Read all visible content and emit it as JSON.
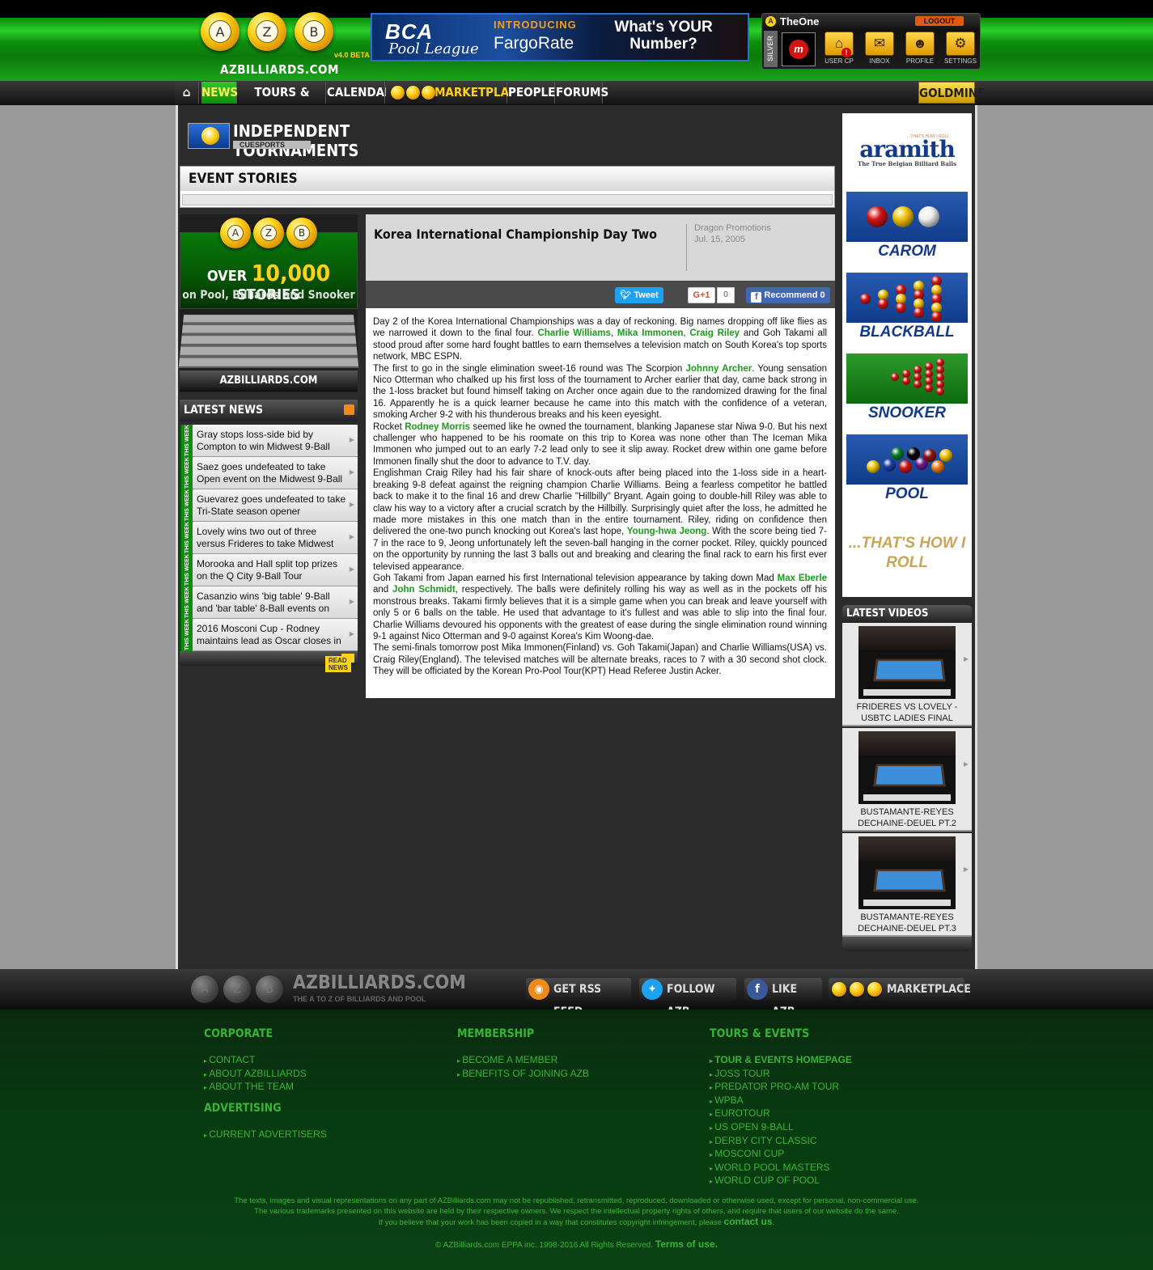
{
  "header": {
    "logo_balls": [
      "A",
      "Z",
      "B"
    ],
    "logo_text": "AZBILLIARDS.COM",
    "version": "v4.0 BETA",
    "banner": {
      "brand": "BCA",
      "league": "Pool League",
      "introducing": "INTRODUCING",
      "product": "FargoRate",
      "question": "What's YOUR Number?"
    },
    "user": {
      "name": "TheOne",
      "logout": "LOGOUT",
      "rank": "SILVER",
      "buttons": [
        "USER CP",
        "INBOX",
        "PROFILE",
        "SETTINGS"
      ]
    }
  },
  "nav": {
    "items": [
      "NEWS",
      "TOURS & EVENTS",
      "CALENDAR",
      "MARKETPLACE",
      "PEOPLE",
      "FORUMS"
    ],
    "goldmine": "GOLDMINE"
  },
  "section": {
    "title": "INDEPENDENT TOURNAMENTS",
    "subtitle": "CUESPORTS",
    "event_stories": "EVENT STORIES"
  },
  "promo": {
    "over": "OVER",
    "count": "10,000",
    "stories": "STORIES",
    "sub": "on Pool, Billiards and Snooker",
    "site": "AZBILLIARDS.COM"
  },
  "latest_news": {
    "title": "LATEST NEWS",
    "badge": "THIS WEEK",
    "items": [
      "Gray stops loss-side bid by Compton to win Midwest 9-Ball",
      "Saez goes undefeated to take Open event on the Midwest 9-Ball",
      "Guevarez goes undefeated to take Tri-State season opener",
      "Lovely wins two out of three versus Frideres to take Midwest",
      "Morooka and Hall split top prizes on the Q City 9-Ball Tour",
      "Casanzio wins 'big table' 9-Ball and 'bar table' 8-Ball events on",
      "2016 Mosconi Cup - Rodney maintains lead as Oscar closes in"
    ],
    "read_more": "READ NEWS"
  },
  "article": {
    "title": "Korea International Championship Day Two",
    "source": "Dragon Promotions",
    "date": "Jul. 15, 2005",
    "tweet": "Tweet",
    "gplus": "G+1",
    "gplus_count": "0",
    "recommend": "Recommend 0",
    "paragraphs": [
      [
        "Day 2 of the Korea International Championships was a day of reckoning. Big names dropping off like flies as we narrowed it down to the final four. ",
        {
          "b": "Charlie Williams"
        },
        ", ",
        {
          "b": "Mika Immonen"
        },
        ", ",
        {
          "b": "Craig Riley"
        },
        " and Goh Takami all stood proud after some hard fought battles to earn themselves a television match on South Korea's top sports network, MBC ESPN."
      ],
      [
        "The first to go in the single elimination sweet-16 round was The Scorpion ",
        {
          "b": "Johnny Archer"
        },
        ". Young sensation Nico Otterman who chalked up his first loss of the tournament to Archer earlier that day, came back strong in the 1-loss bracket but found himself taking on Archer once again due to the randomized drawing for the final 16. Apparently he is a quick learner because he came into this match with the confidence of a veteran, smoking Archer 9-2 with his thunderous breaks and his keen eyesight."
      ],
      [
        "Rocket ",
        {
          "b": "Rodney Morris"
        },
        " seemed like he owned the tournament, blanking Japanese star Niwa 9-0. But his next challenger who happened to be his roomate on this trip to Korea was none other than The Iceman Mika Immonen who jumped out to an early 7-2 lead only to see it slip away. Rocket drew within one game before Immonen finally shut the door to advance to T.V. day."
      ],
      [
        "Englishman Craig Riley had his fair share of knock-outs after being placed into the 1-loss side in a heart-breaking 9-8 defeat against the reigning champion Charlie Williams. Being a fearless competitor he battled back to make it to the final 16 and drew Charlie \"Hillbilly\" Bryant. Again going to double-hill Riley was able to claw his way to a victory after a crucial scratch by the Hillbilly. Surprisingly quiet after the loss, he admitted he made more mistakes in this one match than in the entire tournament. Riley, riding on confidence then delivered the one-two punch knocking out Korea's last hope, ",
        {
          "b": "Young-hwa Jeong"
        },
        ". With the score being tied 7-7 in the race to 9, Jeong unfortunately left the seven-ball hanging in the corner pocket. Riley, quickly pounced on the opportunity by running the last 3 balls out and breaking and clearing the final rack to earn his first ever televised appearance."
      ],
      [
        "Goh Takami from Japan earned his first International television appearance by taking down Mad ",
        {
          "b": "Max Eberle"
        },
        " and ",
        {
          "b": "John Schmidt"
        },
        ", respectively. The balls were definitely rolling his way as well as in the pockets off his monstrous breaks. Takami firmly believes that it is a simple game when you can break and leave yourself with only 5 or 6 balls on the table. He used that advantage to it's fullest and was able to slip into the final four. Charlie Williams devoured his opponents with the greatest of ease during the single elimination round winning 9-1 against Nico Otterman and 9-0 against Korea's Kim Woong-dae."
      ],
      [
        "The semi-finals tomorrow post Mika Immonen(Finland) vs. Goh Takami(Japan) and Charlie Williams(USA) vs. Craig Riley(England). The televised matches will be alternate breaks, races to 7 with a 30 second shot clock. They will be officiated by the Korean Pro-Pool Tour(KPT) Head Referee Justin Acker."
      ]
    ]
  },
  "ad": {
    "brand": "aramith",
    "tagline": "The True Belgian Billiard Balls",
    "slogan_small": "...THAT'S HOW I ROLL",
    "games": [
      "CAROM",
      "BLACKBALL",
      "SNOOKER",
      "POOL"
    ],
    "slogan": "...THAT'S HOW I ROLL"
  },
  "videos": {
    "title": "LATEST VIDEOS",
    "items": [
      "FRIDERES VS LOVELY - USBTC LADIES FINAL",
      "BUSTAMANTE-REYES DECHAINE-DEUEL PT.2",
      "BUSTAMANTE-REYES DECHAINE-DEUEL PT.3"
    ]
  },
  "footer_bar": {
    "site": "AZBILLIARDS.COM",
    "slogan": "THE A TO Z OF BILLIARDS AND POOL",
    "rss": "GET RSS FEED",
    "twitter": "FOLLOW AZB",
    "facebook": "LIKE AZB",
    "marketplace": "MARKETPLACE"
  },
  "footer": {
    "corporate": {
      "title": "CORPORATE",
      "links": [
        "CONTACT",
        "ABOUT AZBILLIARDS",
        "ABOUT THE TEAM"
      ]
    },
    "advertising": {
      "title": "ADVERTISING",
      "links": [
        "CURRENT ADVERTISERS"
      ]
    },
    "membership": {
      "title": "MEMBERSHIP",
      "links": [
        "BECOME A MEMBER",
        "BENEFITS OF JOINING AZB"
      ]
    },
    "tours": {
      "title": "TOURS & EVENTS",
      "links": [
        "TOUR & EVENTS HOMEPAGE",
        "JOSS TOUR",
        "PREDATOR PRO-AM TOUR",
        "WPBA",
        "EUROTOUR",
        "US OPEN 9-BALL",
        "DERBY CITY CLASSIC",
        "MOSCONI CUP",
        "WORLD POOL MASTERS",
        "WORLD CUP OF POOL"
      ]
    },
    "legal1": "The texts, images and visual representations on any part of AZBilliards.com may not be republished, retransmitted, reproduced, downloaded or otherwise used, except for personal, non-commercial use.",
    "legal2": "The various trademarks presented on this website are held by their respective owners. We respect the intellectual property rights of others, and require that users of our website do the same.",
    "legal3": "If you believe that your work has been copied in a way that constitutes copyright infringement, please ",
    "contact_us": "contact us",
    "copyright": "© AZBilliards.com EPPA inc. 1998-2016 All Rights Reserved.",
    "terms": "Terms of use."
  },
  "colors": {
    "accent_green": "#1f9a1f",
    "gold": "#ffd21a",
    "footer_green": "#37b437"
  }
}
